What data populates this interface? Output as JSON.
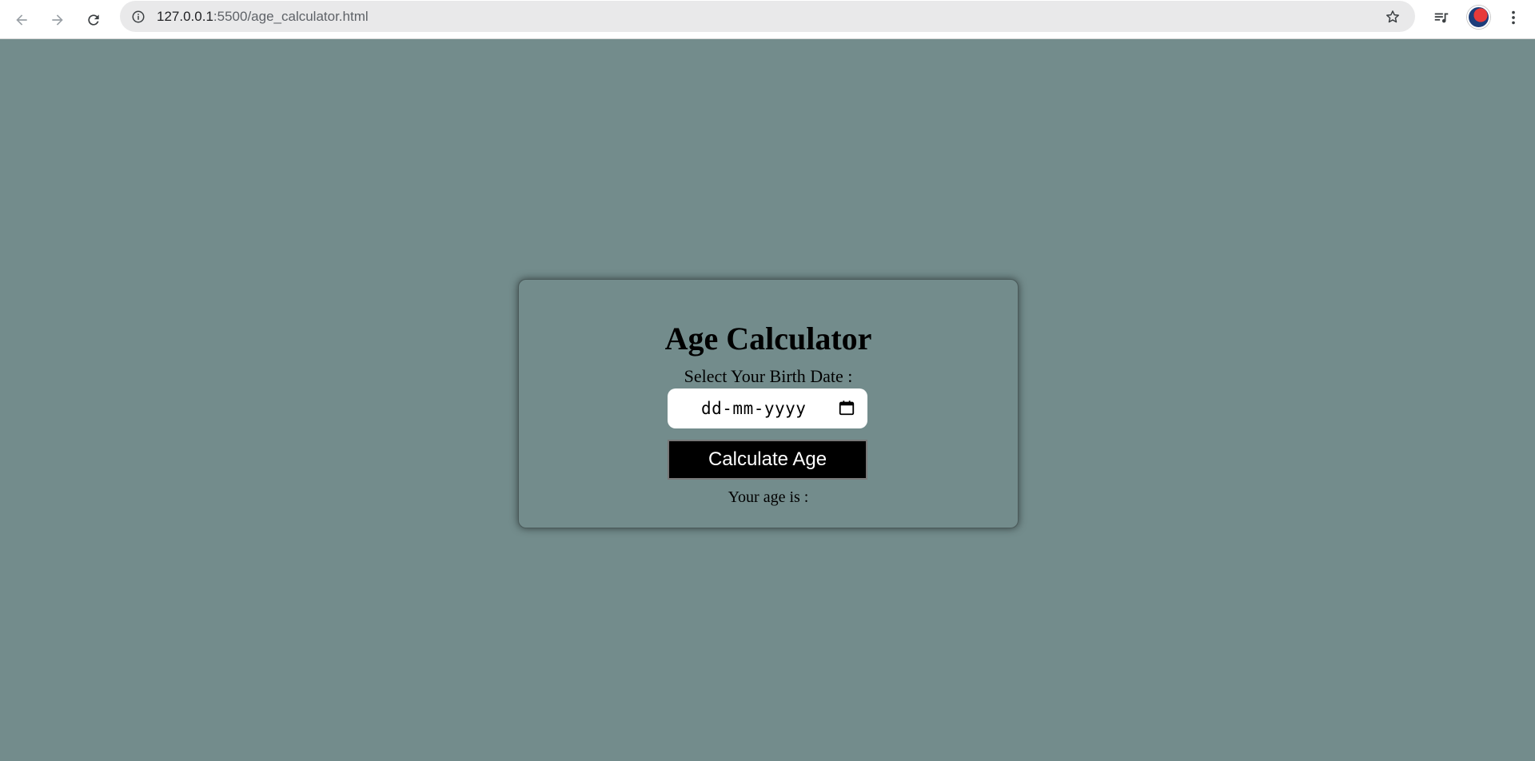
{
  "browser": {
    "url_host": "127.0.0.1",
    "url_rest": ":5500/age_calculator.html",
    "icons": {
      "back": "back-arrow-icon",
      "forward": "forward-arrow-icon",
      "reload": "reload-icon",
      "site_info": "info-icon",
      "bookmark": "star-icon",
      "media": "media-playlist-icon",
      "menu": "kebab-menu-icon"
    }
  },
  "page": {
    "background_color": "#738c8c",
    "title": "Age Calculator",
    "birth_label": "Select Your Birth Date :",
    "date_input": {
      "placeholder": "dd-mm-yyyy",
      "value": ""
    },
    "calculate_button_label": "Calculate Age",
    "result_text": "Your age is :"
  }
}
